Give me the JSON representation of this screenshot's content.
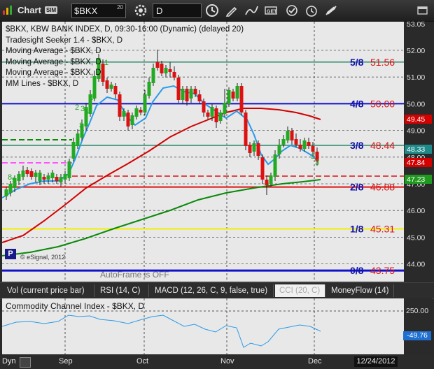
{
  "toolbar": {
    "title": "Chart",
    "sim_badge": "SIM",
    "symbol": "$BKX",
    "symbol_sup": "20",
    "interval": "D"
  },
  "legend": [
    "$BKX, KBW BANK INDEX, D, 09:30-16:00 (Dynamic) (delayed 20)",
    "Tradesight Seeker 1.4 - $BKX, D",
    "Moving Average - $BKX, D",
    "Moving Average - $BKX, D",
    "Moving Average - $BKX, D",
    "MM Lines - $BKX, D"
  ],
  "price_axis": {
    "ticks": [
      "53.05",
      "52.00",
      "51.00",
      "50.00",
      "49.00",
      "48.00",
      "47.00",
      "46.00",
      "45.00",
      "44.00"
    ],
    "badges": [
      {
        "value": "49.45",
        "color": "#d40000"
      },
      {
        "value": "48.33",
        "color": "#1f8a8a"
      },
      {
        "value": "47.84",
        "color": "#d40000"
      },
      {
        "value": "47.23",
        "color": "#1f9a1f"
      }
    ]
  },
  "mm_lines": [
    {
      "fraction": "5/8",
      "value": "51.56"
    },
    {
      "fraction": "4/8",
      "value": "50.00"
    },
    {
      "fraction": "3/8",
      "value": "48.44"
    },
    {
      "fraction": "2/8",
      "value": "46.88"
    },
    {
      "fraction": "1/8",
      "value": "45.31"
    },
    {
      "fraction": "0/8",
      "value": "43.75"
    }
  ],
  "chart_labels": {
    "copyright": "© eSignal, 2012",
    "autoframe": "AutoFrame is OFF",
    "p_badge": "P"
  },
  "tabs": [
    {
      "label": "Vol (current price bar)",
      "active": false
    },
    {
      "label": "RSI (14, C)",
      "active": false
    },
    {
      "label": "MACD (12, 26, C, 9, false, true)",
      "active": false
    },
    {
      "label": "CCI (20, C)",
      "active": true
    },
    {
      "label": "MoneyFlow (14)",
      "active": false
    }
  ],
  "cci": {
    "title": "Commodity Channel Index - $BKX, D",
    "tick": "250.00",
    "value_badge": "-49.76"
  },
  "bottom": {
    "dyn": "Dyn",
    "months": [
      "Sep",
      "Oct",
      "Nov",
      "Dec"
    ],
    "date": "12/24/2012"
  },
  "colors": {
    "chart_bg": "#e8e8e8",
    "up_candle": "#22aa22",
    "down_candle": "#dd1111",
    "ma_fast": "#2a9be8",
    "ma_mid": "#d40000",
    "ma_slow": "#0a8a0a",
    "cci_line": "#2a9be8"
  }
}
